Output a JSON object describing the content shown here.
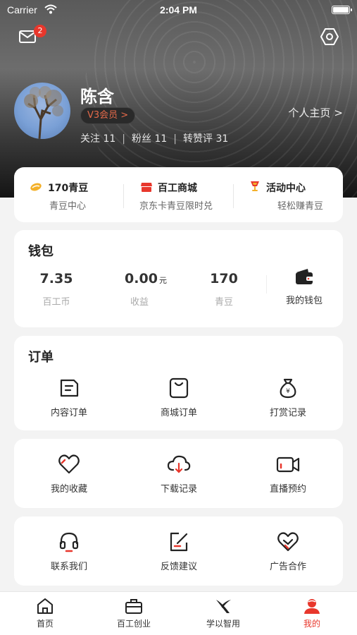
{
  "status": {
    "carrier": "Carrier",
    "time": "2:04 PM"
  },
  "header": {
    "mail_badge": "2"
  },
  "profile": {
    "name": "陈含",
    "vip": "V3会员 >",
    "follow_label": "关注",
    "follow_count": "11",
    "fans_label": "粉丝",
    "fans_count": "11",
    "repost_label": "转赞评",
    "repost_count": "31",
    "homepage": "个人主页",
    "homepage_arrow": ">"
  },
  "quick": [
    {
      "title": "170青豆",
      "sub": "青豆中心",
      "icon": "bean-icon"
    },
    {
      "title": "百工商城",
      "sub": "京东卡青豆限时兑",
      "icon": "shop-icon"
    },
    {
      "title": "活动中心",
      "sub": "轻松赚青豆",
      "icon": "trophy-icon"
    }
  ],
  "wallet": {
    "title": "钱包",
    "items": [
      {
        "value": "7.35",
        "unit": "",
        "label": "百工币"
      },
      {
        "value": "0.00",
        "unit": "元",
        "label": "收益"
      },
      {
        "value": "170",
        "unit": "",
        "label": "青豆"
      }
    ],
    "my_wallet": "我的钱包"
  },
  "orders": {
    "title": "订单",
    "items": [
      {
        "label": "内容订单",
        "icon": "content-order-icon"
      },
      {
        "label": "商城订单",
        "icon": "mall-order-icon"
      },
      {
        "label": "打赏记录",
        "icon": "money-bag-icon"
      }
    ]
  },
  "row2": [
    {
      "label": "我的收藏",
      "icon": "heart-icon"
    },
    {
      "label": "下载记录",
      "icon": "cloud-download-icon"
    },
    {
      "label": "直播预约",
      "icon": "video-camera-icon"
    }
  ],
  "row3": [
    {
      "label": "联系我们",
      "icon": "headset-icon"
    },
    {
      "label": "反馈建议",
      "icon": "edit-icon"
    },
    {
      "label": "广告合作",
      "icon": "handshake-icon"
    }
  ],
  "tabs": [
    {
      "label": "首页",
      "icon": "home-icon"
    },
    {
      "label": "百工创业",
      "icon": "briefcase-icon"
    },
    {
      "label": "学以智用",
      "icon": "logo-x-icon"
    },
    {
      "label": "我的",
      "icon": "person-icon",
      "active": true
    }
  ],
  "colors": {
    "accent": "#e8372c",
    "vip": "#e56a4a"
  }
}
